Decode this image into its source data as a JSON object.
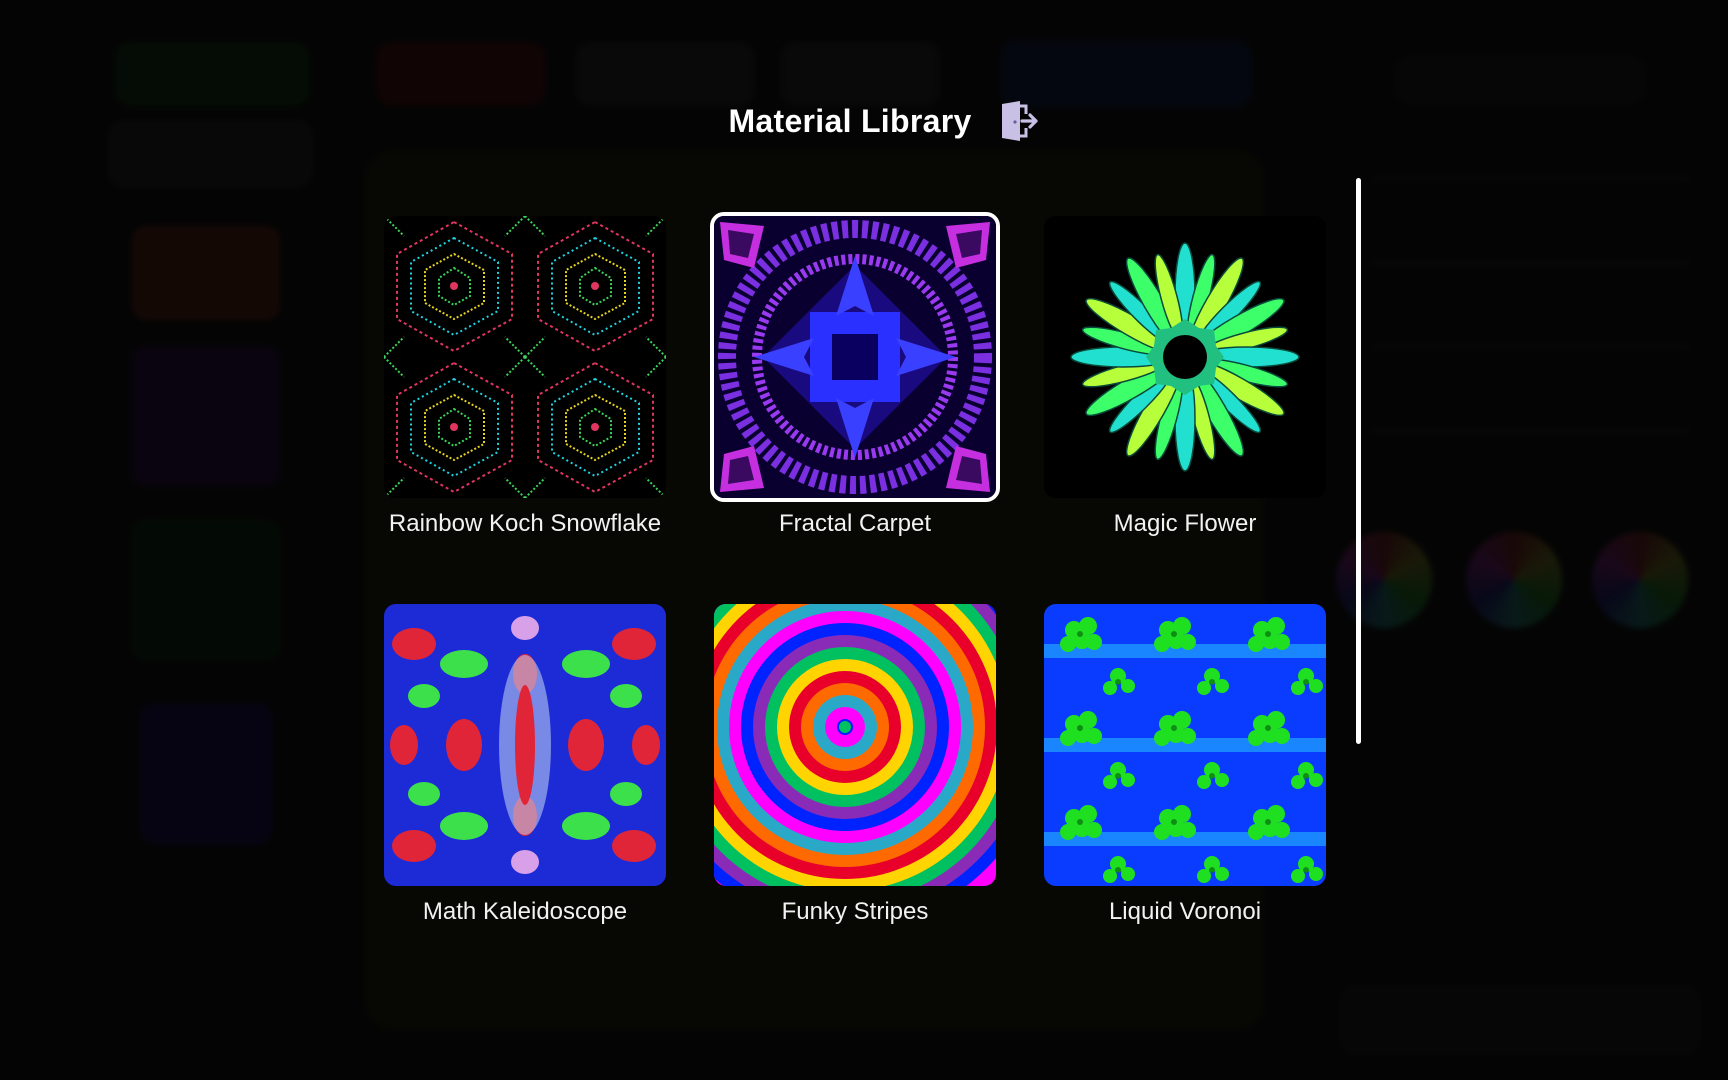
{
  "modal": {
    "title": "Material Library",
    "exit_icon": "exit-door-icon",
    "selected_index": 1,
    "materials": [
      {
        "name": "Rainbow Koch Snowflake",
        "palette": [
          "#000000",
          "#e0355f",
          "#1fd3e0",
          "#e6d21f",
          "#3bd35a"
        ]
      },
      {
        "name": "Fractal Carpet",
        "palette": [
          "#0a0030",
          "#7a2fe0",
          "#2a30ff",
          "#c62fe0"
        ]
      },
      {
        "name": "Magic Flower",
        "palette": [
          "#000000",
          "#22e0d0",
          "#3cff6a",
          "#b6ff3a"
        ]
      },
      {
        "name": "Math Kaleidoscope",
        "palette": [
          "#1d2bd6",
          "#e02538",
          "#3be04a",
          "#d8a0e8"
        ]
      },
      {
        "name": "Funky Stripes",
        "palette": [
          "#ff00ff",
          "#2aa8c8",
          "#ff6a00",
          "#e8002a",
          "#ffd400",
          "#00c060",
          "#8a2bb8",
          "#0022ff"
        ]
      },
      {
        "name": "Liquid Voronoi",
        "palette": [
          "#0a3cff",
          "#1fa6ff",
          "#1fe020",
          "#0a7a10"
        ]
      }
    ]
  }
}
